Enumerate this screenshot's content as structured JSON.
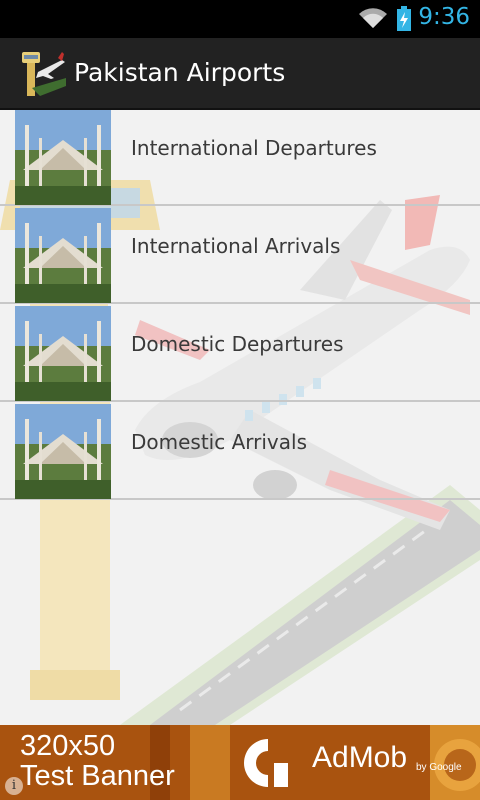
{
  "status_bar": {
    "time": "9:36",
    "wifi_icon": "wifi-icon",
    "battery_icon": "battery-charging-icon"
  },
  "action_bar": {
    "title": "Pakistan Airports",
    "icon": "airport-app-icon"
  },
  "list": {
    "items": [
      {
        "label": "International Departures",
        "thumb": "mosque-photo"
      },
      {
        "label": "International Arrivals",
        "thumb": "mosque-photo"
      },
      {
        "label": "Domestic Departures",
        "thumb": "mosque-photo"
      },
      {
        "label": "Domestic Arrivals",
        "thumb": "mosque-photo"
      }
    ]
  },
  "ad": {
    "line1": "320x50",
    "line2": "Test Banner",
    "brand": "AdMob",
    "by": "by Google",
    "info": "i"
  },
  "colors": {
    "accent": "#33b5e5",
    "action_bar": "#222222",
    "ad_background": "#b45a10"
  }
}
